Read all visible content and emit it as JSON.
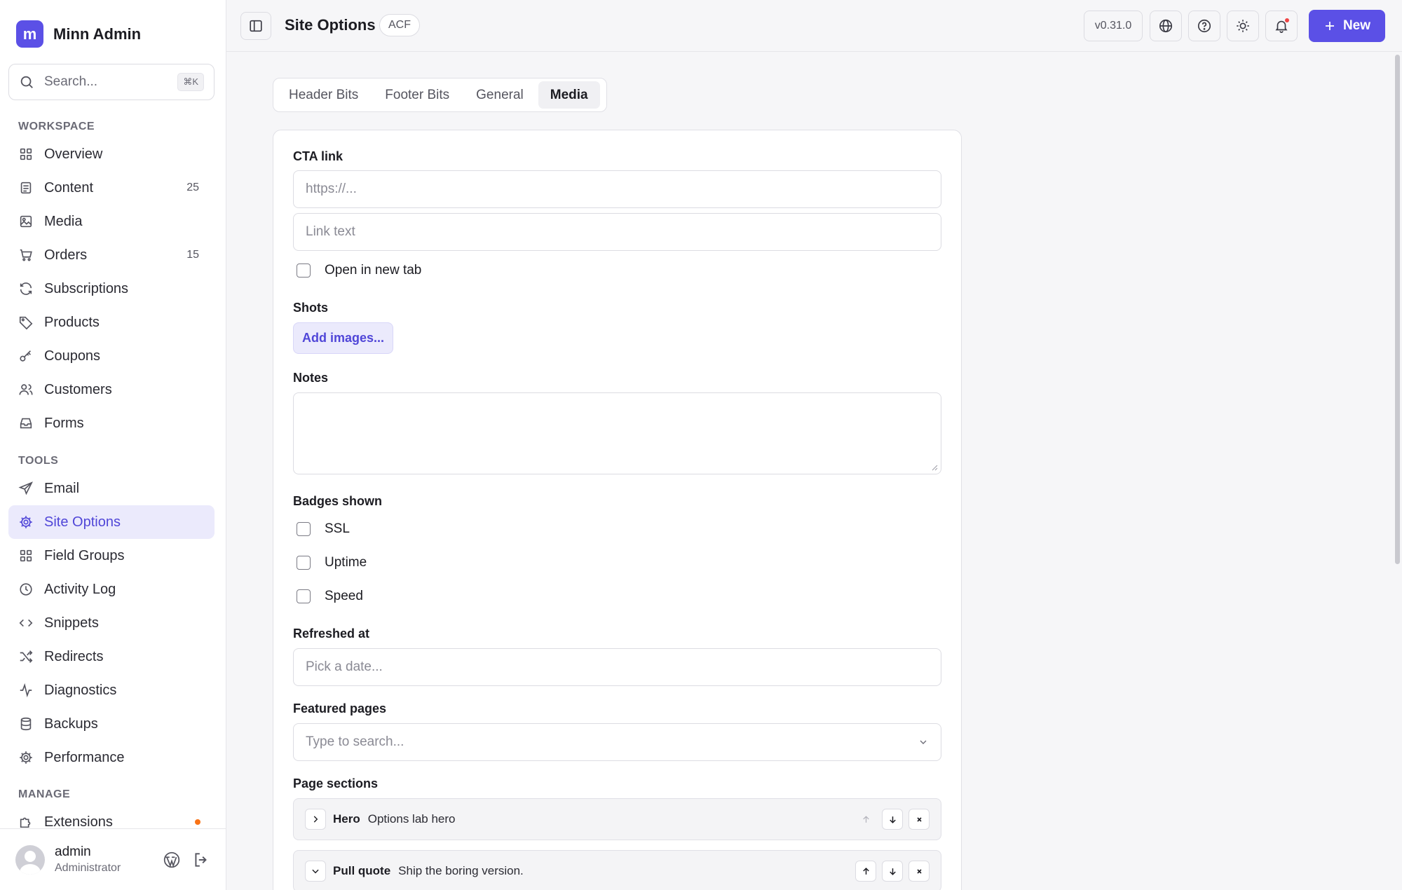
{
  "app": {
    "logo_letter": "m",
    "name": "Minn Admin"
  },
  "search": {
    "placeholder": "Search...",
    "shortcut": "⌘K"
  },
  "sidebar": {
    "sections": [
      {
        "label": "WORKSPACE"
      },
      {
        "label": "TOOLS"
      },
      {
        "label": "MANAGE"
      }
    ],
    "workspace": [
      {
        "label": "Overview",
        "icon": "grid-icon"
      },
      {
        "label": "Content",
        "icon": "document-icon",
        "count": "25"
      },
      {
        "label": "Media",
        "icon": "image-icon"
      },
      {
        "label": "Orders",
        "icon": "cart-icon",
        "count": "15"
      },
      {
        "label": "Subscriptions",
        "icon": "refresh-icon"
      },
      {
        "label": "Products",
        "icon": "tag-icon"
      },
      {
        "label": "Coupons",
        "icon": "key-icon"
      },
      {
        "label": "Customers",
        "icon": "users-icon"
      },
      {
        "label": "Forms",
        "icon": "inbox-icon"
      }
    ],
    "tools": [
      {
        "label": "Email",
        "icon": "send-icon"
      },
      {
        "label": "Site Options",
        "icon": "gear-icon",
        "active": true
      },
      {
        "label": "Field Groups",
        "icon": "grid-icon"
      },
      {
        "label": "Activity Log",
        "icon": "clock-icon"
      },
      {
        "label": "Snippets",
        "icon": "code-icon"
      },
      {
        "label": "Redirects",
        "icon": "shuffle-icon"
      },
      {
        "label": "Diagnostics",
        "icon": "pulse-icon"
      },
      {
        "label": "Backups",
        "icon": "database-icon"
      },
      {
        "label": "Performance",
        "icon": "gear-icon"
      }
    ],
    "manage": [
      {
        "label": "Extensions",
        "icon": "puzzle-icon"
      }
    ]
  },
  "user": {
    "name": "admin",
    "role": "Administrator"
  },
  "topbar": {
    "title": "Site Options",
    "badge": "ACF",
    "version": "v0.31.0",
    "new_label": "New"
  },
  "tabs": [
    {
      "label": "Header Bits"
    },
    {
      "label": "Footer Bits"
    },
    {
      "label": "General"
    },
    {
      "label": "Media",
      "active": true
    }
  ],
  "form": {
    "cta_label": "CTA link",
    "cta_url_placeholder": "https://...",
    "cta_text_placeholder": "Link text",
    "new_tab_label": "Open in new tab",
    "shots_label": "Shots",
    "add_images_label": "Add images...",
    "notes_label": "Notes",
    "badges_label": "Badges shown",
    "badges": [
      "SSL",
      "Uptime",
      "Speed"
    ],
    "refreshed_label": "Refreshed at",
    "date_placeholder": "Pick a date...",
    "featured_label": "Featured pages",
    "featured_placeholder": "Type to search...",
    "sections_label": "Page sections",
    "sections": [
      {
        "type": "Hero",
        "title": "Options lab hero"
      },
      {
        "type": "Pull quote",
        "title": "Ship the boring version."
      }
    ]
  },
  "colors": {
    "accent": "#5b50e6",
    "accent_soft": "#ebeafc",
    "notification": "#ef4444"
  }
}
